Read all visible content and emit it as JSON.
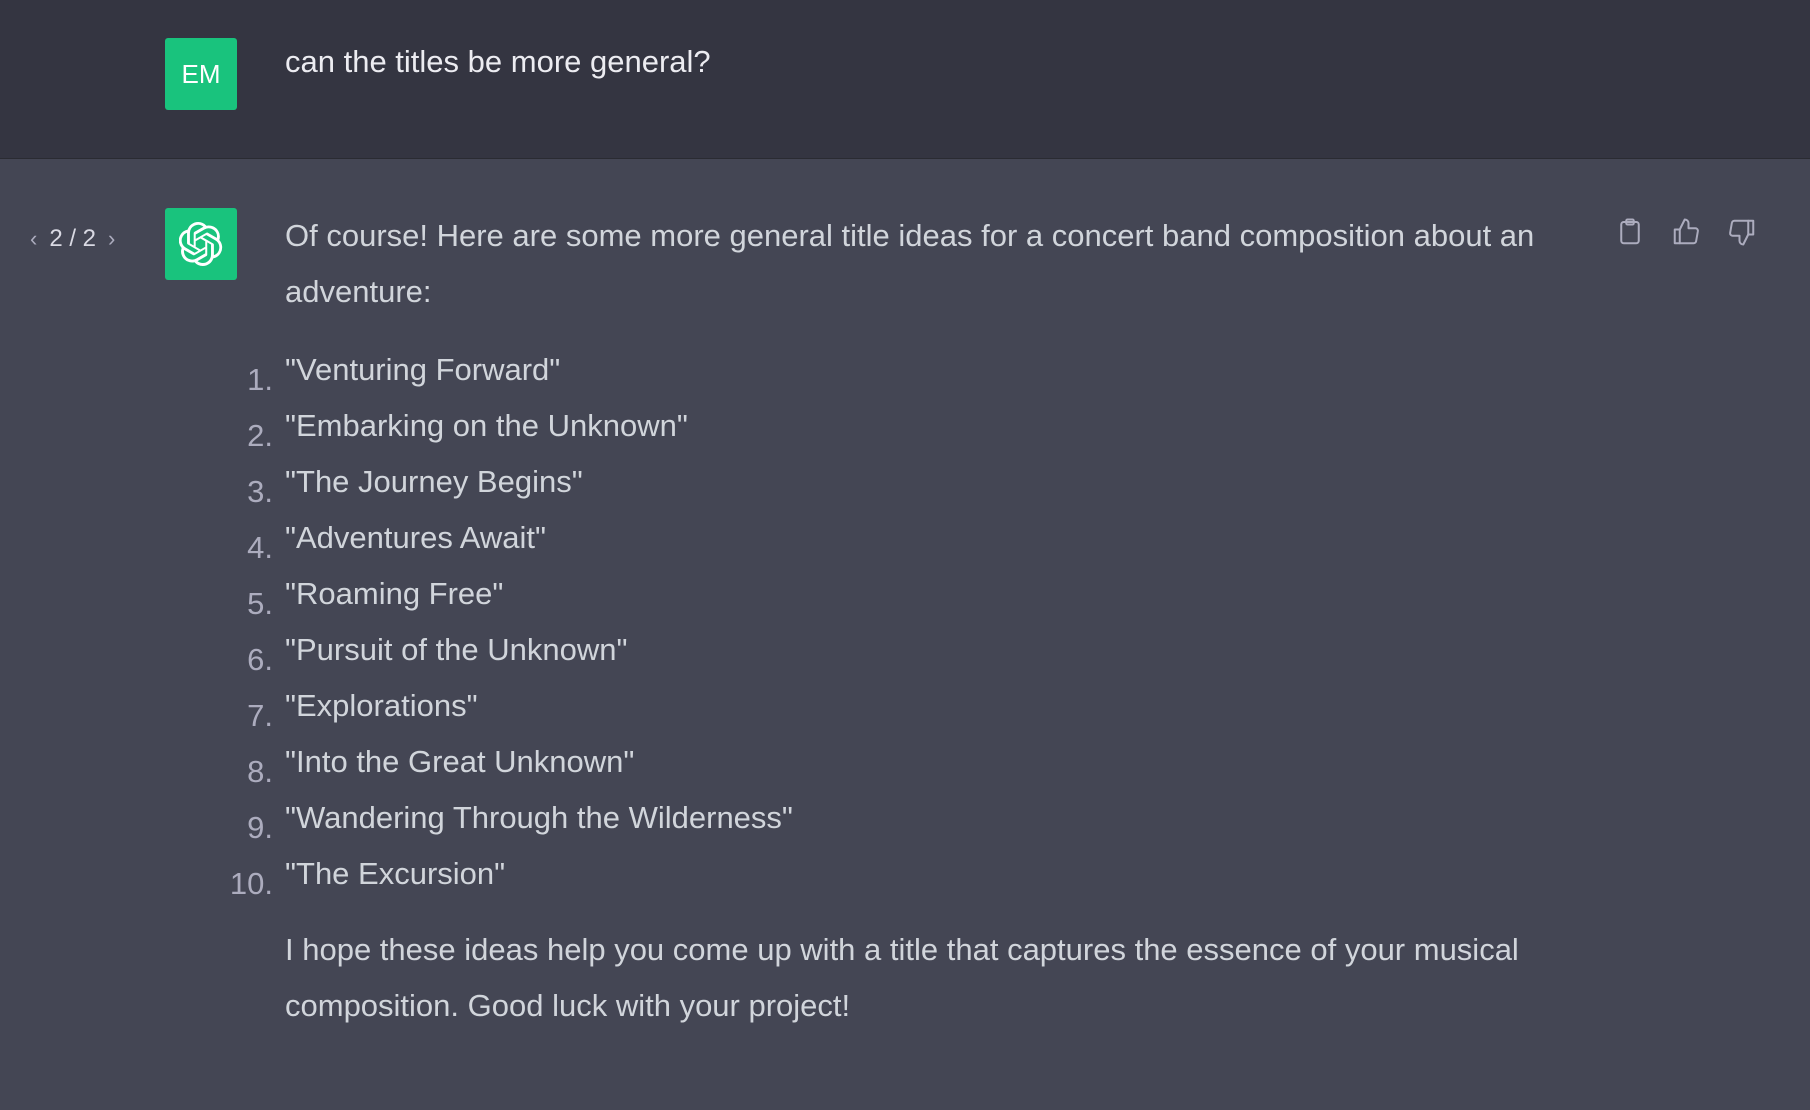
{
  "user_message": {
    "avatar_initials": "EM",
    "text": "can the titles be more general?"
  },
  "assistant_message": {
    "pager": {
      "current": "2 / 2",
      "prev_icon": "chevron-left-icon",
      "next_icon": "chevron-right-icon"
    },
    "avatar_icon": "openai-logo-icon",
    "intro": "Of course! Here are some more general title ideas for a concert band composition about an adventure:",
    "titles": [
      {
        "num": "1.",
        "text": "\"Venturing Forward\""
      },
      {
        "num": "2.",
        "text": "\"Embarking on the Unknown\""
      },
      {
        "num": "3.",
        "text": "\"The Journey Begins\""
      },
      {
        "num": "4.",
        "text": "\"Adventures Await\""
      },
      {
        "num": "5.",
        "text": "\"Roaming Free\""
      },
      {
        "num": "6.",
        "text": "\"Pursuit of the Unknown\""
      },
      {
        "num": "7.",
        "text": "\"Explorations\""
      },
      {
        "num": "8.",
        "text": "\"Into the Great Unknown\""
      },
      {
        "num": "9.",
        "text": "\"Wandering Through the Wilderness\""
      },
      {
        "num": "10.",
        "text": "\"The Excursion\""
      }
    ],
    "closing": "I hope these ideas help you come up with a title that captures the essence of your musical composition. Good luck with your project!",
    "actions": [
      "clipboard-icon",
      "thumbs-up-icon",
      "thumbs-down-icon"
    ]
  },
  "colors": {
    "user_bg": "#343541",
    "assistant_bg": "#444654",
    "avatar_green": "#19c37d"
  }
}
